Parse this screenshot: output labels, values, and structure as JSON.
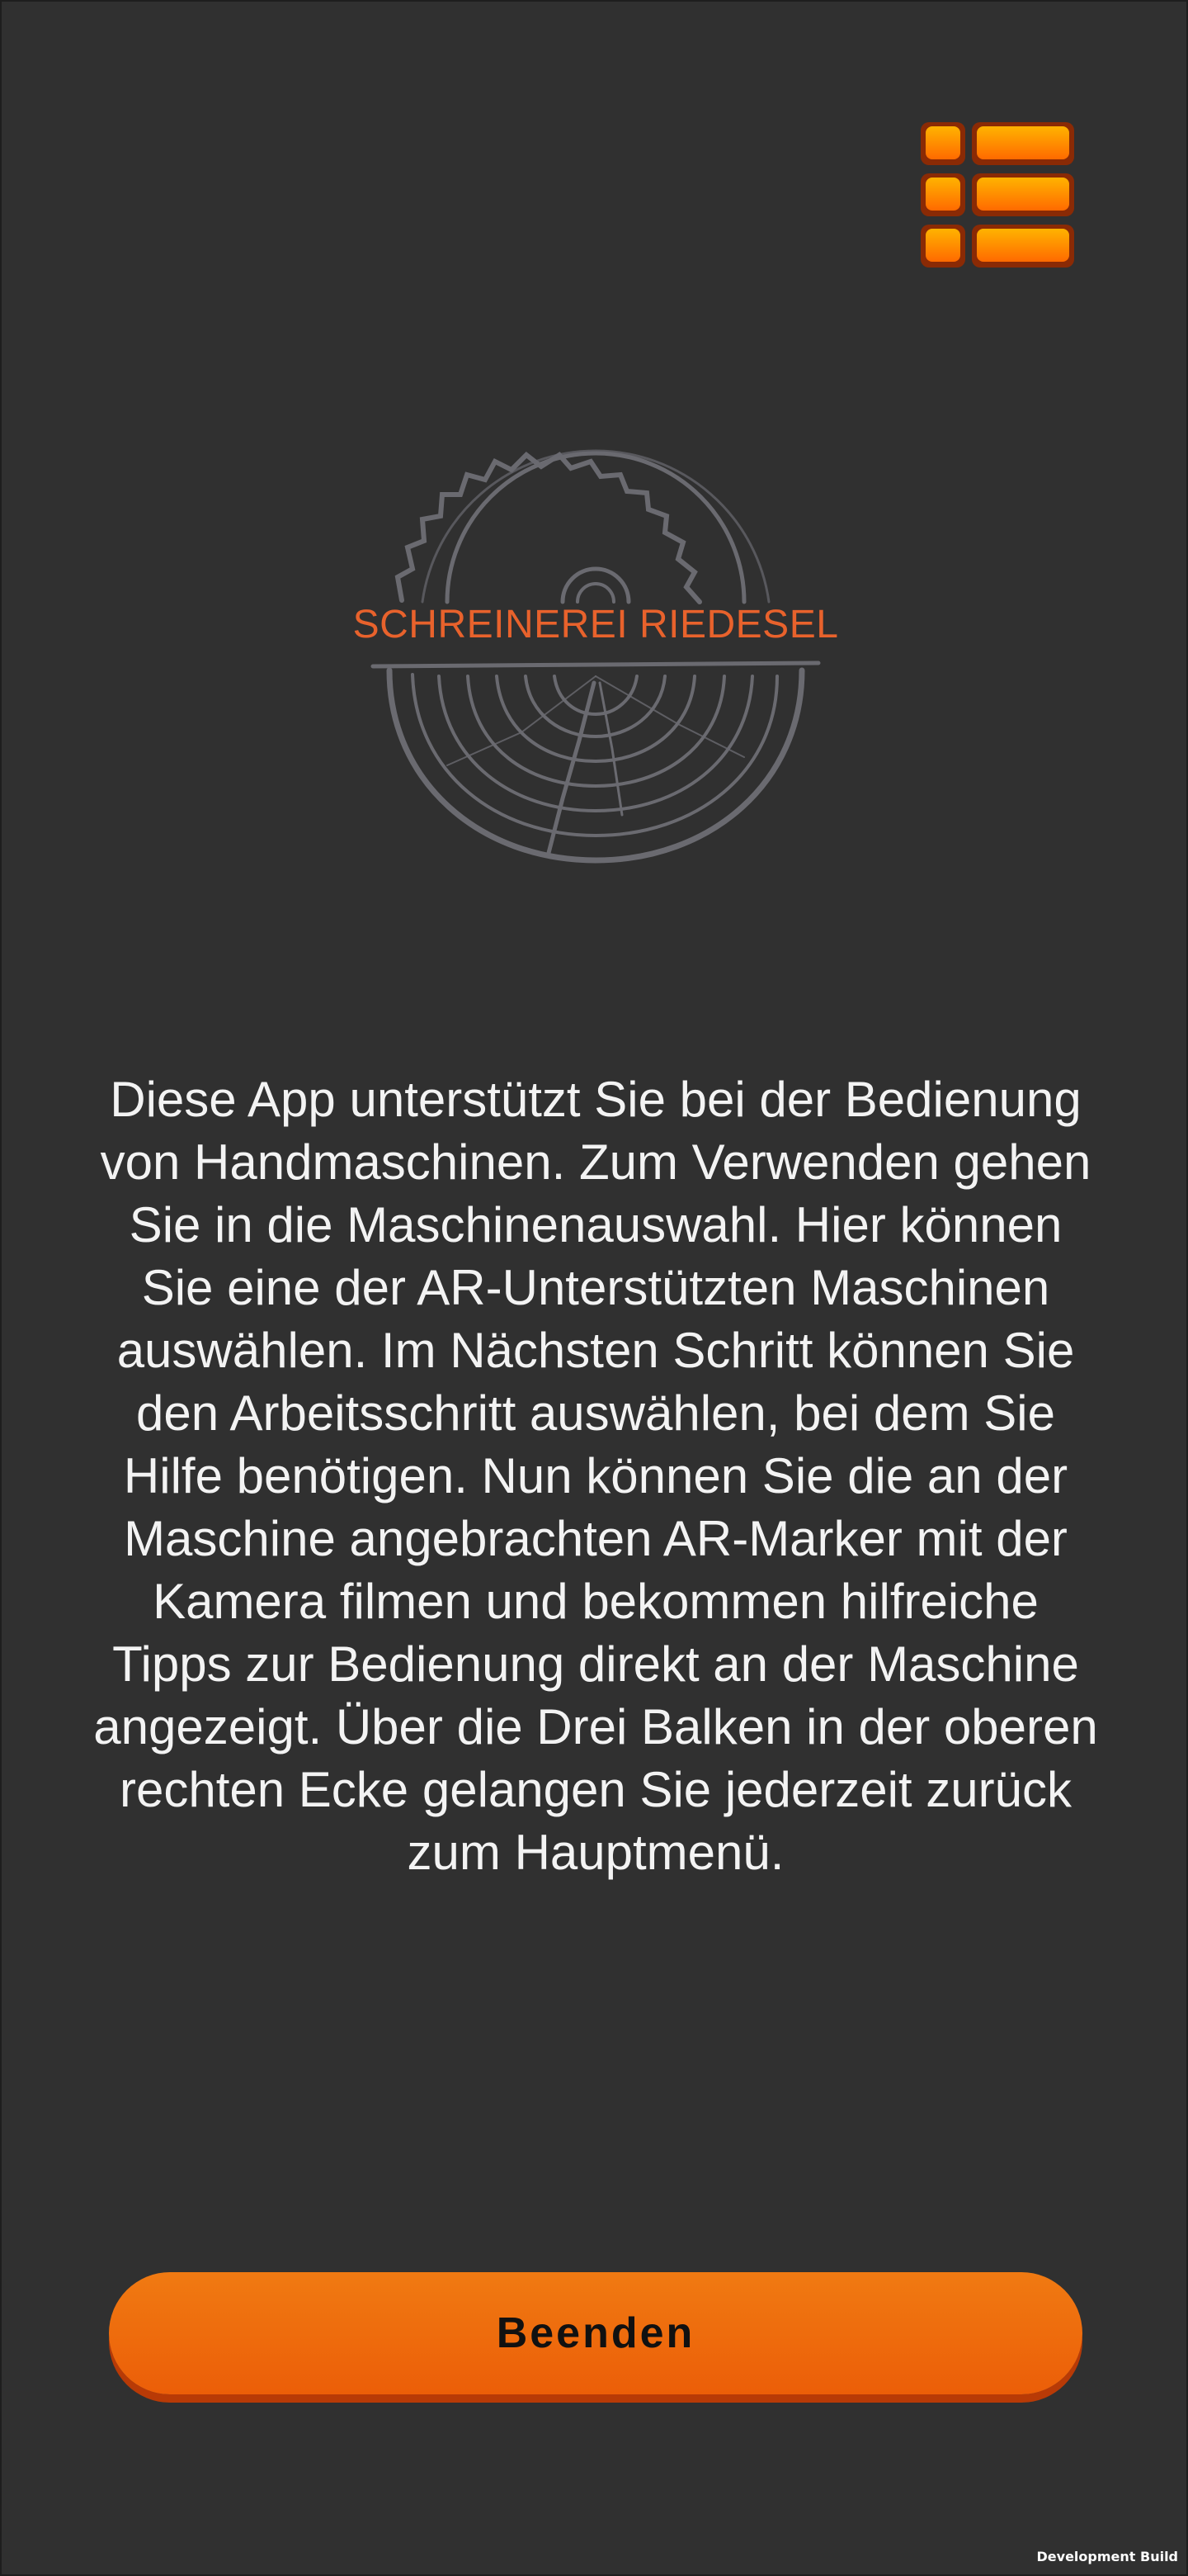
{
  "header": {
    "menu_icon": "menu-bars-icon"
  },
  "logo": {
    "title": "SCHREINEREI RIEDESEL",
    "icon": "saw-blade-tree-rings-icon"
  },
  "main": {
    "description": "Diese App unterstützt Sie bei der Bedienung von Handmaschinen. Zum Verwenden gehen Sie in die Maschinenauswahl. Hier können Sie eine der AR-Unterstützten Maschinen auswählen. Im Nächsten Schritt können Sie den Arbeitsschritt auswählen, bei dem Sie Hilfe benötigen. Nun können Sie die an der Maschine angebrachten AR-Marker mit der Kamera filmen und bekommen hilfreiche Tipps zur Bedienung direkt an der Maschine angezeigt. Über die Drei Balken in der oberen rechten Ecke gelangen Sie jederzeit zurück zum Hauptmenü."
  },
  "actions": {
    "finish_label": "Beenden"
  },
  "footer": {
    "build_label": "Development Build"
  },
  "colors": {
    "background": "#303030",
    "accent": "#f07a12",
    "logo_text": "#e8622c",
    "logo_lines": "#6a6a70"
  }
}
